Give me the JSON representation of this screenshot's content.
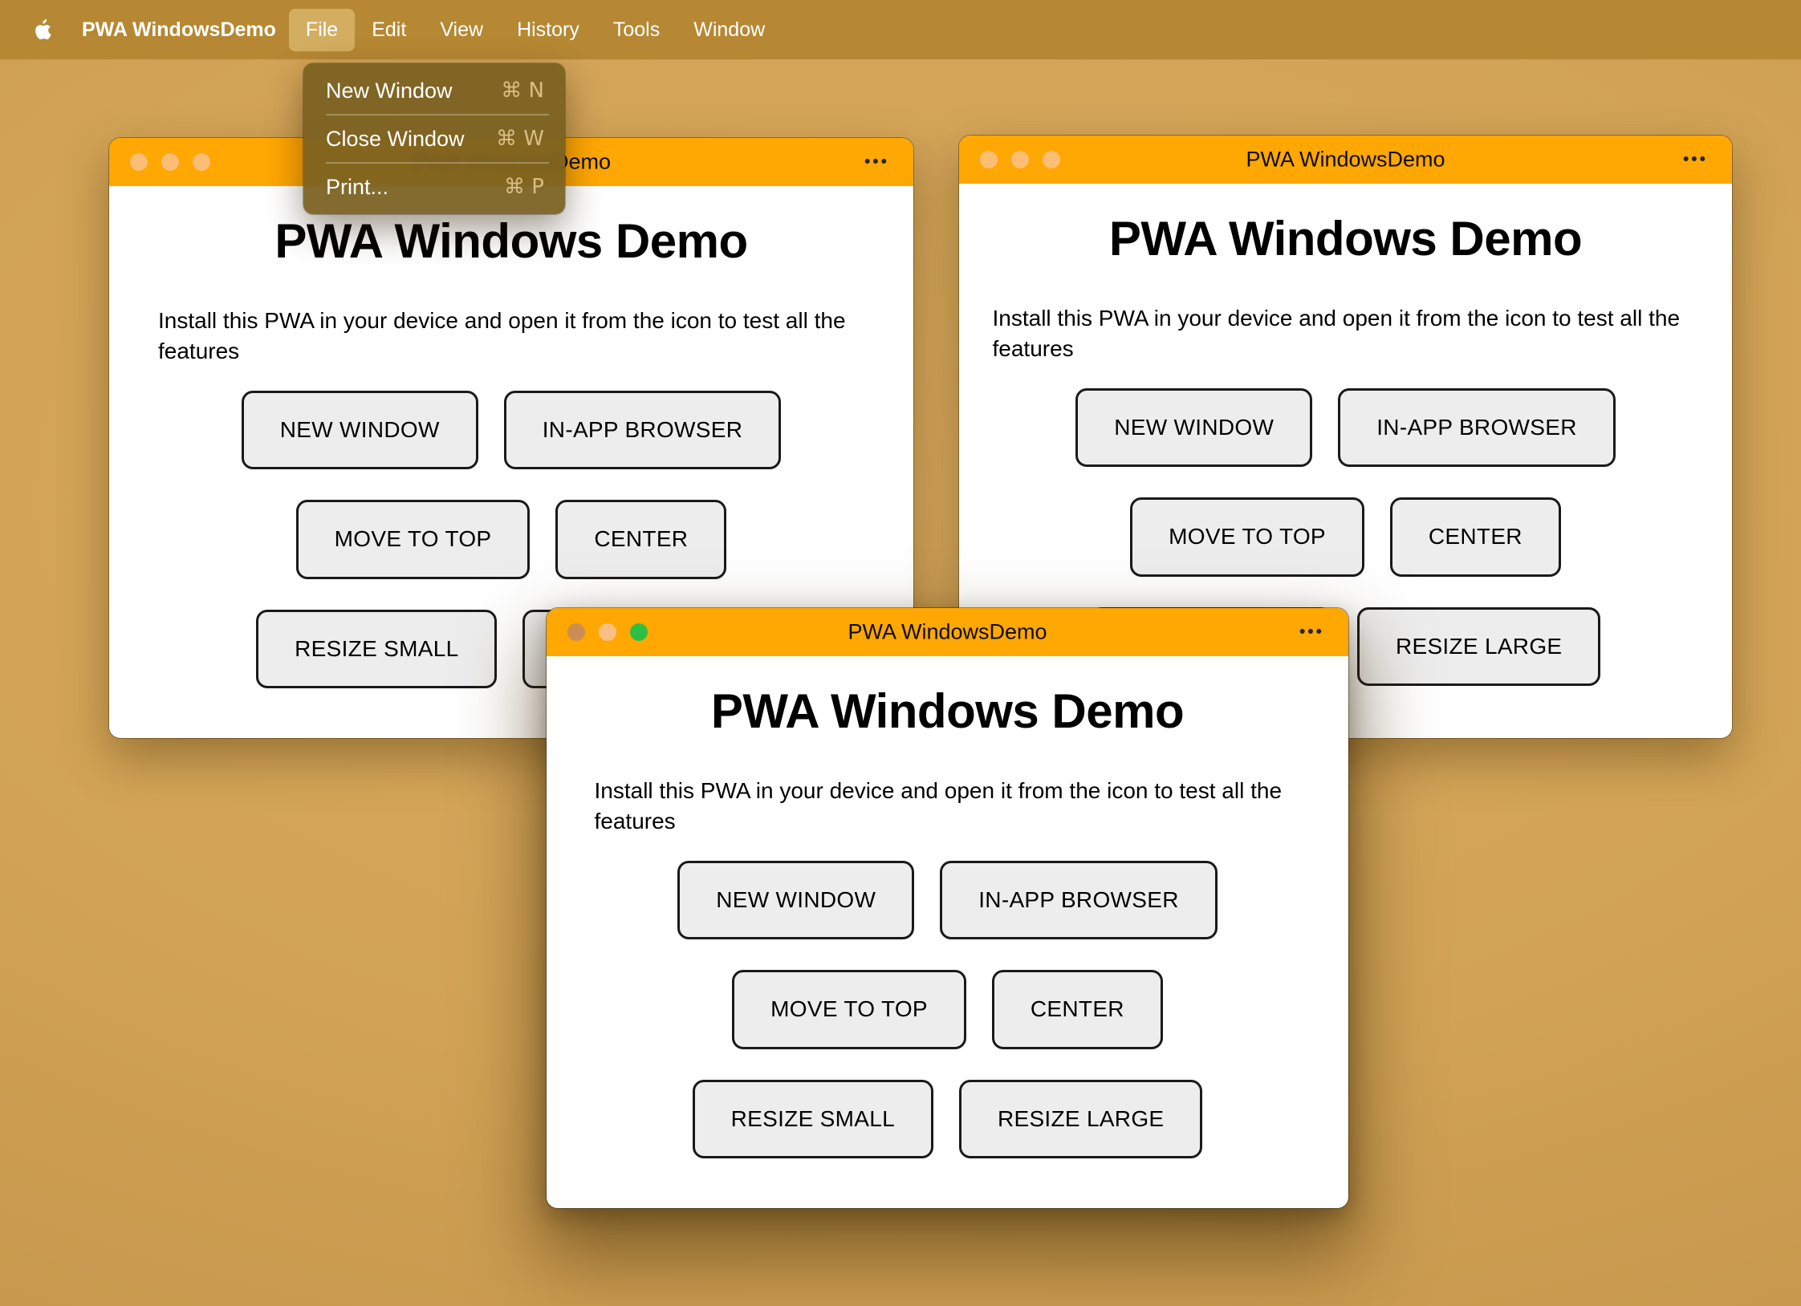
{
  "menu_bar": {
    "app_name": "PWA WindowsDemo",
    "items": [
      "File",
      "Edit",
      "View",
      "History",
      "Tools",
      "Window"
    ],
    "active_item": "File"
  },
  "file_menu": {
    "items": [
      {
        "label": "New Window",
        "shortcut": "⌘ N"
      },
      {
        "label": "Close Window",
        "shortcut": "⌘ W"
      },
      {
        "label": "Print...",
        "shortcut": "⌘ P"
      }
    ]
  },
  "window_chrome": {
    "title": "PWA WindowsDemo",
    "overflow_menu_glyph": "•••"
  },
  "app": {
    "heading": "PWA Windows Demo",
    "description": "Install this PWA in your device and open it from the icon to test all the features",
    "buttons": [
      "NEW WINDOW",
      "IN-APP BROWSER",
      "MOVE TO TOP",
      "CENTER",
      "RESIZE SMALL",
      "RESIZE LARGE"
    ]
  },
  "colors": {
    "desktop": "#d2a356",
    "menu_bar": "#b68833",
    "menu_highlight": "#d3ae60",
    "dropdown_bg": "rgba(122,96,32,0.93)",
    "titlebar": "#ffa702",
    "traffic_lights_inactive": "#fcbd74",
    "traffic_lights_front": [
      "#cb8d52",
      "#f8c183",
      "#2fbf45"
    ],
    "button_bg": "#ededed",
    "button_border": "#1a1a1a"
  }
}
